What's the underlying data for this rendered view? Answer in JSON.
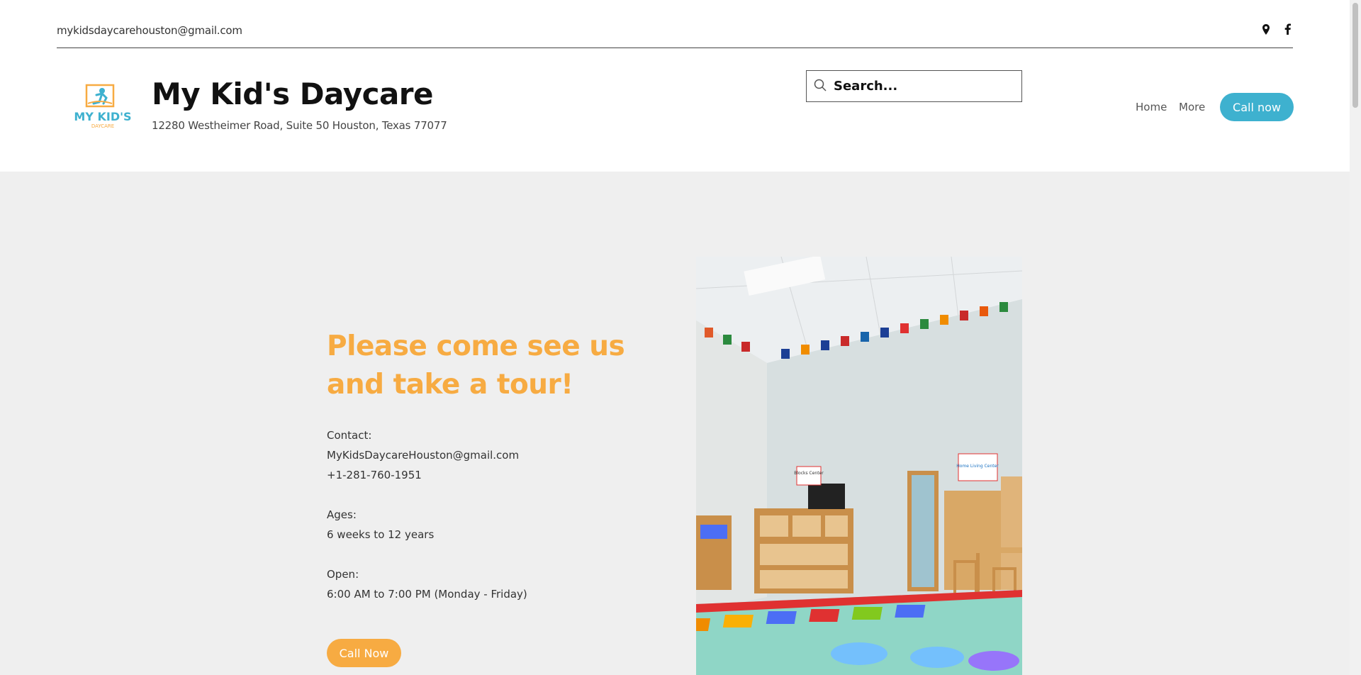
{
  "topbar": {
    "email": "mykidsdaycarehouston@gmail.com",
    "icons": [
      "map-pin-icon",
      "facebook-icon"
    ]
  },
  "header": {
    "logo_text": "MY KID'S",
    "logo_subtext": "DAYCARE",
    "title": "My Kid's Daycare",
    "address": "12280 Westheimer Road, Suite 50 Houston, Texas 77077",
    "search_placeholder": "Search...",
    "nav": {
      "home": "Home",
      "more": "More"
    },
    "call_button": "Call now"
  },
  "main": {
    "headline": "Please come see us and take a tour!",
    "contact_label": "Contact:",
    "contact_email": "MyKidsDaycareHouston@gmail.com",
    "contact_phone": "+1-281-760-1951",
    "ages_label": "Ages:",
    "ages_value": "6 weeks to 12 years",
    "open_label": "Open:",
    "open_value": "6:00 AM to 7:00 PM (Monday - Friday)",
    "call_button": "Call Now",
    "photo_signs": [
      "Blocks Center",
      "Home Living Center"
    ]
  },
  "colors": {
    "accent_orange": "#f7ab42",
    "accent_blue": "#3eb1cf",
    "background_gray": "#efefef"
  }
}
